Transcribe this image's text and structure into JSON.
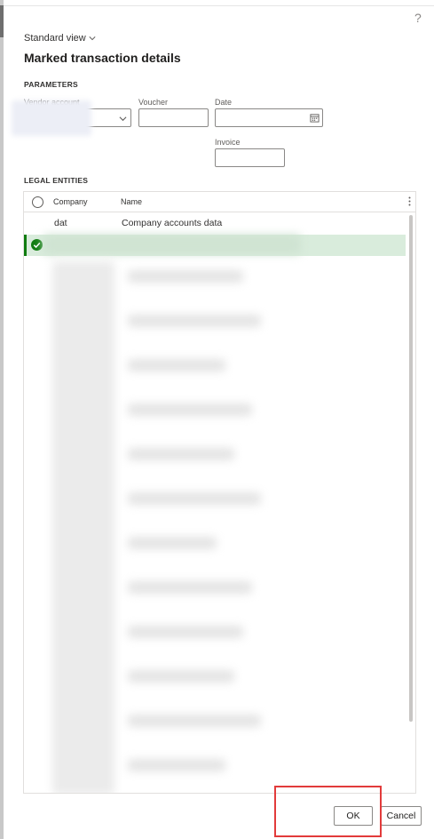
{
  "header": {
    "help_symbol": "?",
    "view_label": "Standard view",
    "title": "Marked transaction details"
  },
  "parameters": {
    "section_label": "PARAMETERS",
    "vendor_account_label": "Vendor account",
    "voucher_label": "Voucher",
    "date_label": "Date",
    "invoice_label": "Invoice"
  },
  "legal_entities": {
    "section_label": "LEGAL ENTITIES",
    "columns": [
      "Company",
      "Name"
    ],
    "rows": [
      {
        "company": "dat",
        "name": "Company accounts data",
        "selected": false
      }
    ]
  },
  "footer": {
    "ok_label": "OK",
    "cancel_label": "Cancel"
  },
  "colors": {
    "accent": "#107c10",
    "selected_row": "#d9ecdc",
    "highlight_box": "#e23b3b"
  },
  "icons": {
    "view_dropdown": "chevron-down-icon",
    "vendor_dropdown": "chevron-down-icon",
    "date_picker": "calendar-icon",
    "row_selected": "checkmark-circle-icon",
    "column_options": "more-vertical-icon"
  }
}
